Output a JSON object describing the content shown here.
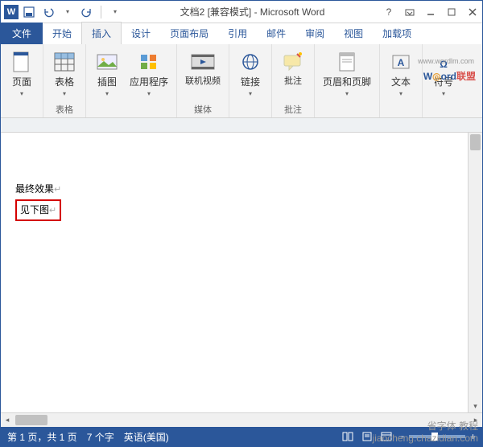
{
  "title": "文档2 [兼容模式] - Microsoft Word",
  "qat": {
    "save": "保存",
    "undo": "撤销",
    "redo": "重做"
  },
  "tabs": {
    "file": "文件",
    "home": "开始",
    "insert": "插入",
    "design": "设计",
    "layout": "页面布局",
    "references": "引用",
    "mailings": "邮件",
    "review": "审阅",
    "view": "视图",
    "addins": "加载项"
  },
  "ribbon": {
    "page": "页面",
    "table": "表格",
    "illust": "插图",
    "apps": "应用程序",
    "video": "联机视频",
    "links": "链接",
    "comments": "批注",
    "headerfooter": "页眉和页脚",
    "text": "文本",
    "symbols": "符号",
    "g_table": "表格",
    "g_media": "媒体",
    "g_comments": "批注"
  },
  "logo": {
    "url": "www.wordlm.com",
    "w": "W",
    "ord": "ord",
    "lm": "联盟"
  },
  "doc": {
    "line1": "最终效果",
    "line2": "见下图"
  },
  "status": {
    "page": "第 1 页，共 1 页",
    "words": "7 个字",
    "lang": "英语(美国)",
    "zoom": "100%"
  },
  "watermark": {
    "l1": "省字体 教程",
    "l2": "jiaocheng.chazidian.com"
  }
}
